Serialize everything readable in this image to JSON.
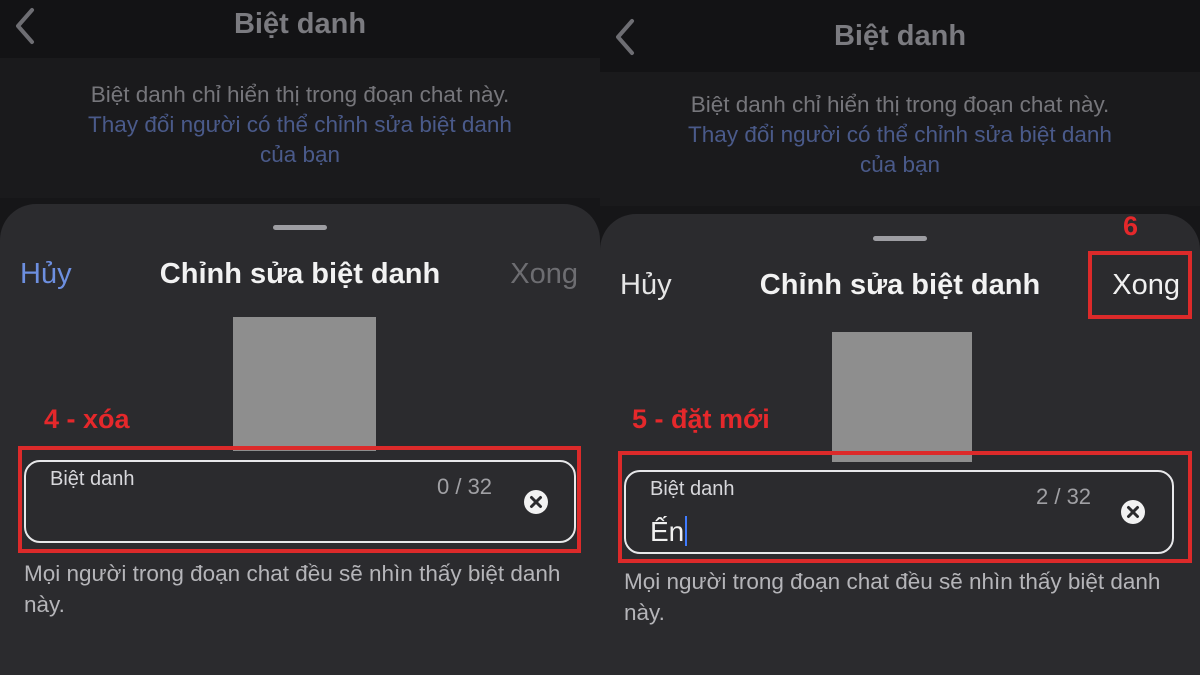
{
  "colors": {
    "accent_link": "#6d8fe0",
    "annotation_red": "#dc2a2a",
    "sheet_background": "#2b2b2e",
    "page_background": "#161618"
  },
  "icons": {
    "back": "chevron-left-icon",
    "clear": "clear-circle-x-icon"
  },
  "left": {
    "title": "Biệt danh",
    "info_line": "Biệt danh chỉ hiển thị trong đoạn chat này.",
    "info_link_1": "Thay đổi người có thể chỉnh sửa biệt danh",
    "info_link_2": "của bạn",
    "sheet": {
      "cancel": "Hủy",
      "title": "Chỉnh sửa biệt danh",
      "done": "Xong",
      "field_label": "Biệt danh",
      "counter": "0 / 32",
      "value": "",
      "helper": "Mọi người trong đoạn chat đều sẽ nhìn thấy biệt danh này."
    },
    "annotation": "4 - xóa"
  },
  "right": {
    "title": "Biệt danh",
    "info_line": "Biệt danh chỉ hiển thị trong đoạn chat này.",
    "info_link_1": "Thay đổi người có thể chỉnh sửa biệt danh",
    "info_link_2": "của bạn",
    "sheet": {
      "cancel": "Hủy",
      "title": "Chỉnh sửa biệt danh",
      "done": "Xong",
      "field_label": "Biệt danh",
      "counter": "2 / 32",
      "value": "Ến",
      "helper": "Mọi người trong đoạn chat đều sẽ nhìn thấy biệt danh này."
    },
    "annotation": "5 - đặt mới",
    "annotation_done": "6"
  }
}
